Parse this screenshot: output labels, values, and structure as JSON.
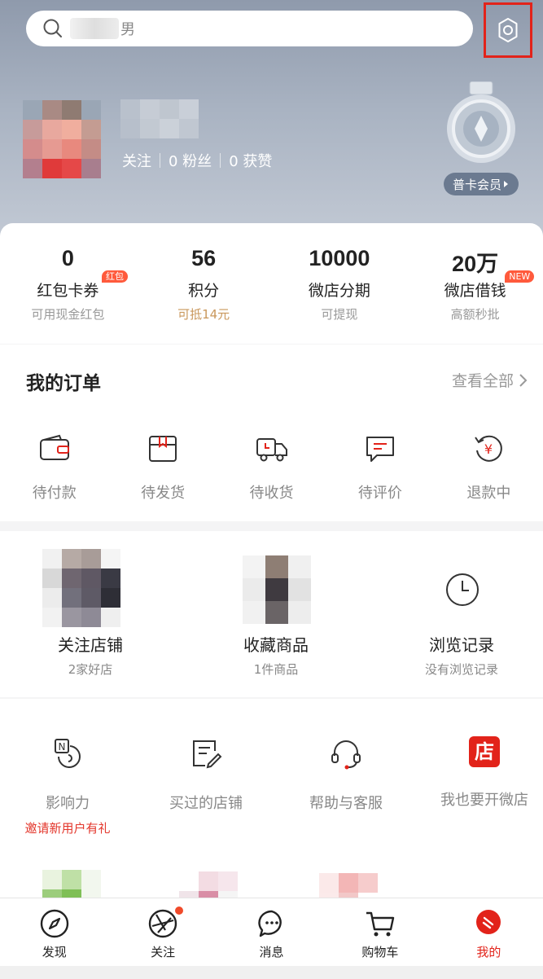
{
  "search": {
    "text": "男"
  },
  "profile": {
    "follow_label": "关注",
    "fans": "0 粉丝",
    "likes": "0 获赞",
    "member_label": "普卡会员"
  },
  "stats": [
    {
      "value": "0",
      "label": "红包卡券",
      "sub": "可用现金红包",
      "badge": "红包"
    },
    {
      "value": "56",
      "label": "积分",
      "sub": "可抵14元"
    },
    {
      "value": "10000",
      "label": "微店分期",
      "sub": "可提现"
    },
    {
      "value": "20万",
      "label": "微店借钱",
      "sub": "高额秒批",
      "badge": "NEW"
    }
  ],
  "orders": {
    "title": "我的订单",
    "view_all": "查看全部",
    "items": [
      {
        "label": "待付款",
        "icon": "wallet-icon"
      },
      {
        "label": "待发货",
        "icon": "package-icon"
      },
      {
        "label": "待收货",
        "icon": "truck-icon"
      },
      {
        "label": "待评价",
        "icon": "comment-icon"
      },
      {
        "label": "退款中",
        "icon": "refund-icon"
      }
    ]
  },
  "favorites": [
    {
      "title": "关注店铺",
      "sub": "2家好店"
    },
    {
      "title": "收藏商品",
      "sub": "1件商品"
    },
    {
      "title": "浏览记录",
      "sub": "没有浏览记录"
    }
  ],
  "tools": [
    {
      "title": "影响力",
      "sub": "邀请新用户有礼",
      "icon": "influence-icon"
    },
    {
      "title": "买过的店铺",
      "icon": "edit-list-icon"
    },
    {
      "title": "帮助与客服",
      "icon": "headset-icon"
    },
    {
      "title": "我也要开微店",
      "icon": "shop-icon",
      "icon_text": "店"
    }
  ],
  "tabbar": [
    {
      "label": "发现",
      "icon": "compass-icon"
    },
    {
      "label": "关注",
      "icon": "aperture-icon"
    },
    {
      "label": "消息",
      "icon": "chat-icon"
    },
    {
      "label": "购物车",
      "icon": "cart-icon"
    },
    {
      "label": "我的",
      "icon": "me-icon",
      "active": true
    }
  ],
  "colors": {
    "accent": "#e2231a",
    "gold": "#c9975b",
    "header": "#a9b3c2"
  }
}
